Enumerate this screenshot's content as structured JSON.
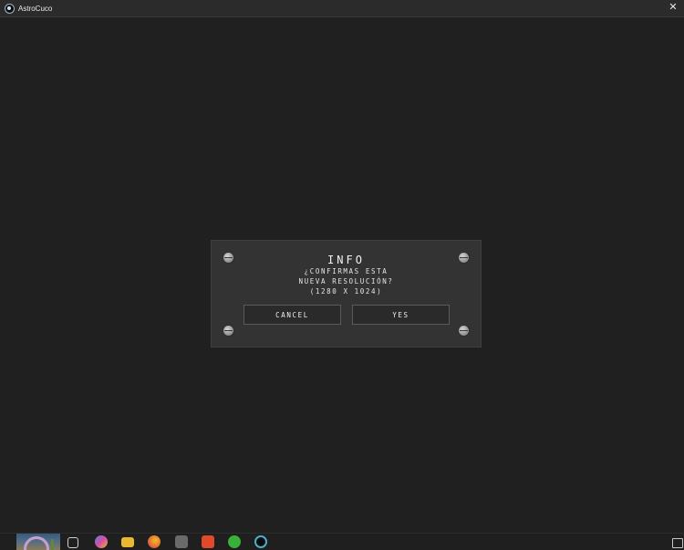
{
  "window": {
    "title": "AstroCuco",
    "close_glyph": "✕"
  },
  "dialog": {
    "title": "INFO",
    "message_line1": "¿CONFIRMAS ESTA",
    "message_line2": "NUEVA RESOLUCIÓN?",
    "message_line3": "(1280 X 1024)",
    "cancel_label": "CANCEL",
    "yes_label": "YES"
  },
  "taskbar": {
    "items": [
      {
        "name": "weather-widget-icon"
      },
      {
        "name": "task-view-icon",
        "color": "#d0d0d0"
      },
      {
        "name": "copilot-icon",
        "color": "#4a8ad8"
      },
      {
        "name": "file-explorer-icon",
        "color": "#e8b830"
      },
      {
        "name": "firefox-icon",
        "color": "#e86a2a"
      },
      {
        "name": "wolf-app-icon",
        "color": "#9a9a9a"
      },
      {
        "name": "brave-icon",
        "color": "#e04a2a"
      },
      {
        "name": "green-app-icon",
        "color": "#3ab03a"
      },
      {
        "name": "astrocuco-app-icon",
        "color": "#4ab0c8"
      },
      {
        "name": "notification-icon",
        "color": "#c8c8c8"
      }
    ]
  }
}
